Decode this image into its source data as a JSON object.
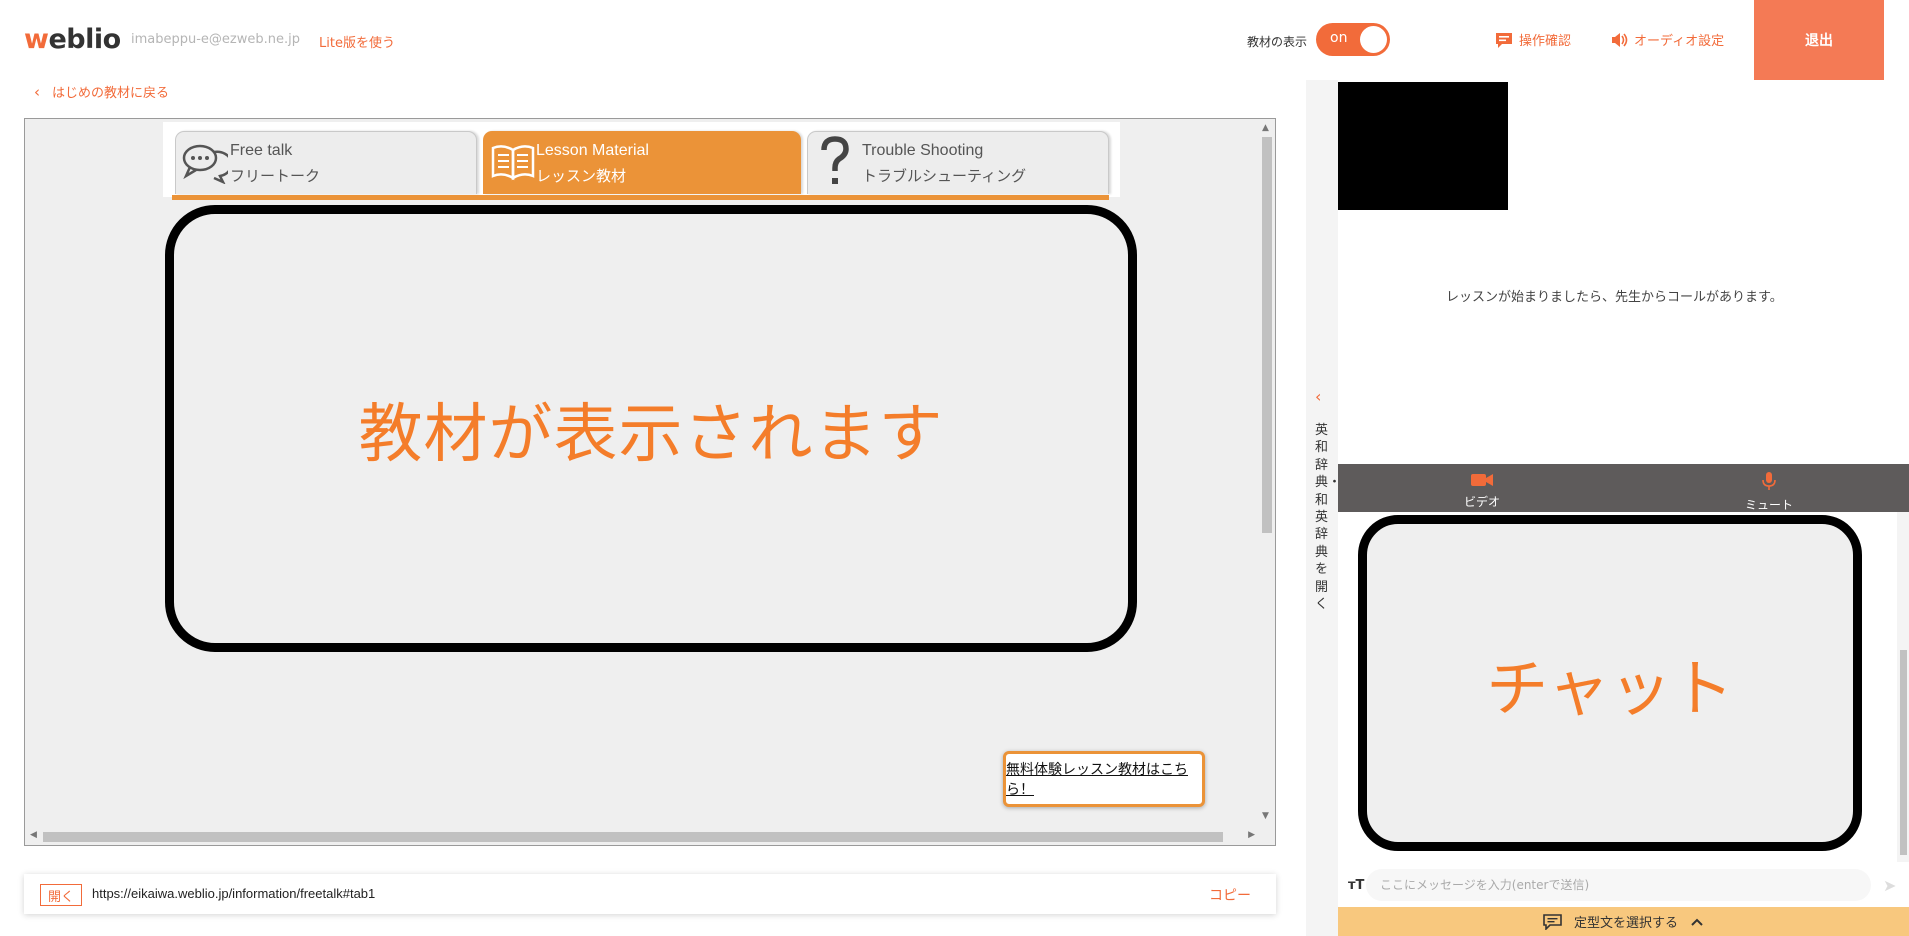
{
  "header": {
    "logo_w": "w",
    "logo_rest": "eblio",
    "email": "imabeppu-e@ezweb.ne.jp",
    "lite_link": "Lite版を使う",
    "material_toggle_label": "教材の表示",
    "toggle_state": "on",
    "operation_check": "操作確認",
    "audio_settings": "オーディオ設定",
    "exit": "退出"
  },
  "back_link": "はじめの教材に戻る",
  "material": {
    "tabs": [
      {
        "title": "Free talk",
        "subtitle": "フリートーク",
        "icon": "speech-bubbles-icon",
        "active": false
      },
      {
        "title": "Lesson Material",
        "subtitle": "レッスン教材",
        "icon": "open-book-icon",
        "active": true
      },
      {
        "title": "Trouble Shooting",
        "subtitle": "トラブルシューティング",
        "icon": "question-mark-icon",
        "active": false
      }
    ],
    "placeholder": "教材が表示されます",
    "trial_link": "無料体験レッスン教材はこちら！"
  },
  "url_bar": {
    "open_label": "開く",
    "url": "https://eikaiwa.weblio.jp/information/freetalk#tab1",
    "copy_label": "コピー"
  },
  "dictionary": {
    "label": "英和辞典・和英辞典を開く"
  },
  "right_panel": {
    "lesson_message": "レッスンが始まりましたら、先生からコールがあります。",
    "video_label": "ビデオ",
    "mute_label": "ミュート",
    "chat_placeholder_big": "チャット",
    "message_placeholder": "ここにメッセージを入力(enterで送信)",
    "font_size_icon": "тT",
    "template_label": "定型文を選択する"
  },
  "colors": {
    "accent": "#f26b3a",
    "tab_active": "#eb9338",
    "exit_bg": "#f47a55",
    "media_bar": "#5e5b5b",
    "template_bar": "#f8c87e"
  }
}
